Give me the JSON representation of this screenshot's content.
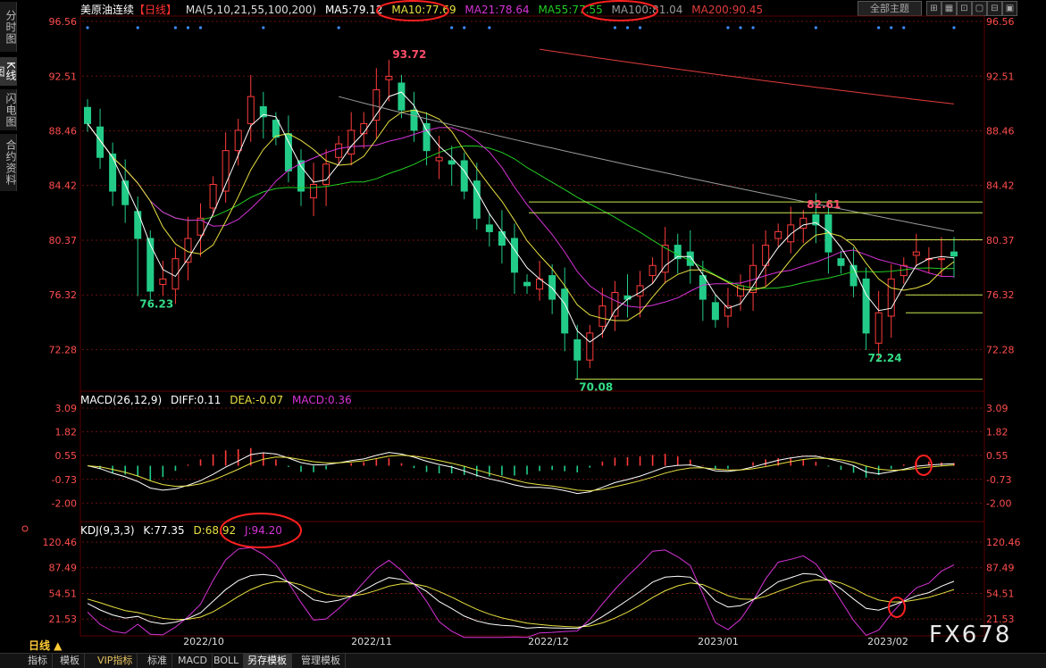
{
  "app": {
    "side_tabs": [
      "分时图",
      "K线图",
      "闪电图",
      "合约资料"
    ],
    "active_side_tab": "K线图",
    "theme_button": "全部主题",
    "window_buttons": [
      "⊞",
      "▦",
      "⊡",
      "▢",
      "⊟",
      "▣"
    ],
    "period_label": "日线 ▲",
    "bottom_tabs": [
      "指标",
      "模板",
      "VIP指标",
      "标准",
      "MACD",
      "BOLL",
      "另存模板",
      "管理模板"
    ],
    "active_bottom_tab": "另存模板",
    "watermark": "FX678"
  },
  "price_header": {
    "symbol": "美原油连续",
    "period": "【日线】",
    "ma_params": "MA(5,10,21,55,100,200)",
    "ma5": "MA5:79.12",
    "ma10": "MA10:77.69",
    "ma21": "MA21:78.64",
    "ma55": "MA55:77.55",
    "ma100": "MA100:81.04",
    "ma200": "MA200:90.45"
  },
  "macd_header": {
    "name": "MACD(26,12,9)",
    "diff": "DIFF:0.11",
    "dea": "DEA:-0.07",
    "macd": "MACD:0.36"
  },
  "kdj_header": {
    "name": "KDJ(9,3,3)",
    "k": "K:77.35",
    "d": "D:68.92",
    "j": "J:94.20"
  },
  "colors": {
    "up": "#ff3b3b",
    "down": "#22cc88",
    "ma5": "#ffffff",
    "ma10": "#e8e040",
    "ma21": "#d633d6",
    "ma55": "#22cc22",
    "ma100": "#9a9a9a",
    "ma200": "#e23c3c",
    "axis_text": "#ff4d4d",
    "grid": "#6a1010",
    "annotation": "#ff2020",
    "hline": "#c8e850"
  },
  "chart_data": [
    {
      "type": "candlestick",
      "title": "美原油连续【日线】",
      "y_ticks": [
        72.28,
        76.32,
        80.37,
        84.42,
        88.46,
        92.51,
        96.56
      ],
      "ylim": [
        69.0,
        96.56
      ],
      "x_labels": [
        "2022/10",
        "2022/11",
        "2022/12",
        "2023/01",
        "2023/02"
      ],
      "grid": true,
      "point_labels": [
        {
          "index": 24,
          "value": 93.72,
          "label": "93.72",
          "kind": "high"
        },
        {
          "index": 4,
          "value": 76.23,
          "label": "76.23",
          "kind": "low"
        },
        {
          "index": 39,
          "value": 70.08,
          "label": "70.08",
          "kind": "low"
        },
        {
          "index": 57,
          "value": 82.61,
          "label": "82.61",
          "kind": "high"
        },
        {
          "index": 62,
          "value": 72.24,
          "label": "72.24",
          "kind": "low"
        }
      ],
      "horizontal_levels": [
        83.2,
        82.4,
        80.4,
        76.32,
        75.0,
        70.08
      ],
      "circled_header_values": [
        "MA10:77.69",
        "MA100:81.04"
      ],
      "closes": [
        89.0,
        86.5,
        84.0,
        83.0,
        80.5,
        76.6,
        77.5,
        79.0,
        80.5,
        82.0,
        84.5,
        87.0,
        88.5,
        91.0,
        89.5,
        88.0,
        85.5,
        84.0,
        84.5,
        86.0,
        87.5,
        88.5,
        89.0,
        91.5,
        92.5,
        90.0,
        88.5,
        87.0,
        86.5,
        86.0,
        84.0,
        82.0,
        81.0,
        80.0,
        78.0,
        77.0,
        77.5,
        76.0,
        73.5,
        71.5,
        73.5,
        75.5,
        76.5,
        76.0,
        77.0,
        78.5,
        80.0,
        79.0,
        78.5,
        76.0,
        74.5,
        75.5,
        77.0,
        78.5,
        80.0,
        81.0,
        81.5,
        82.0,
        81.5,
        79.5,
        78.5,
        77.0,
        73.5,
        75.0,
        77.5,
        78.5,
        79.5,
        79.0,
        79.0,
        79.2
      ],
      "series": [
        {
          "name": "MA5",
          "last": 79.12
        },
        {
          "name": "MA10",
          "last": 77.69
        },
        {
          "name": "MA21",
          "last": 78.64
        },
        {
          "name": "MA55",
          "last": 77.55
        },
        {
          "name": "MA100",
          "last": 81.04
        },
        {
          "name": "MA200",
          "last": 90.45
        }
      ]
    },
    {
      "type": "bar",
      "title": "MACD(26,12,9)",
      "y_ticks": [
        3.09,
        1.82,
        0.55,
        -0.73,
        -2.0
      ],
      "ylim": [
        -2.8,
        3.09
      ],
      "series": [
        {
          "name": "DIFF",
          "last": 0.11
        },
        {
          "name": "DEA",
          "last": -0.07
        },
        {
          "name": "MACD",
          "last": 0.36
        }
      ]
    },
    {
      "type": "line",
      "title": "KDJ(9,3,3)",
      "y_ticks": [
        120.46,
        87.49,
        54.51,
        21.53
      ],
      "ylim": [
        0,
        125
      ],
      "series": [
        {
          "name": "K",
          "last": 77.35
        },
        {
          "name": "D",
          "last": 68.92
        },
        {
          "name": "J",
          "last": 94.2
        }
      ]
    }
  ]
}
